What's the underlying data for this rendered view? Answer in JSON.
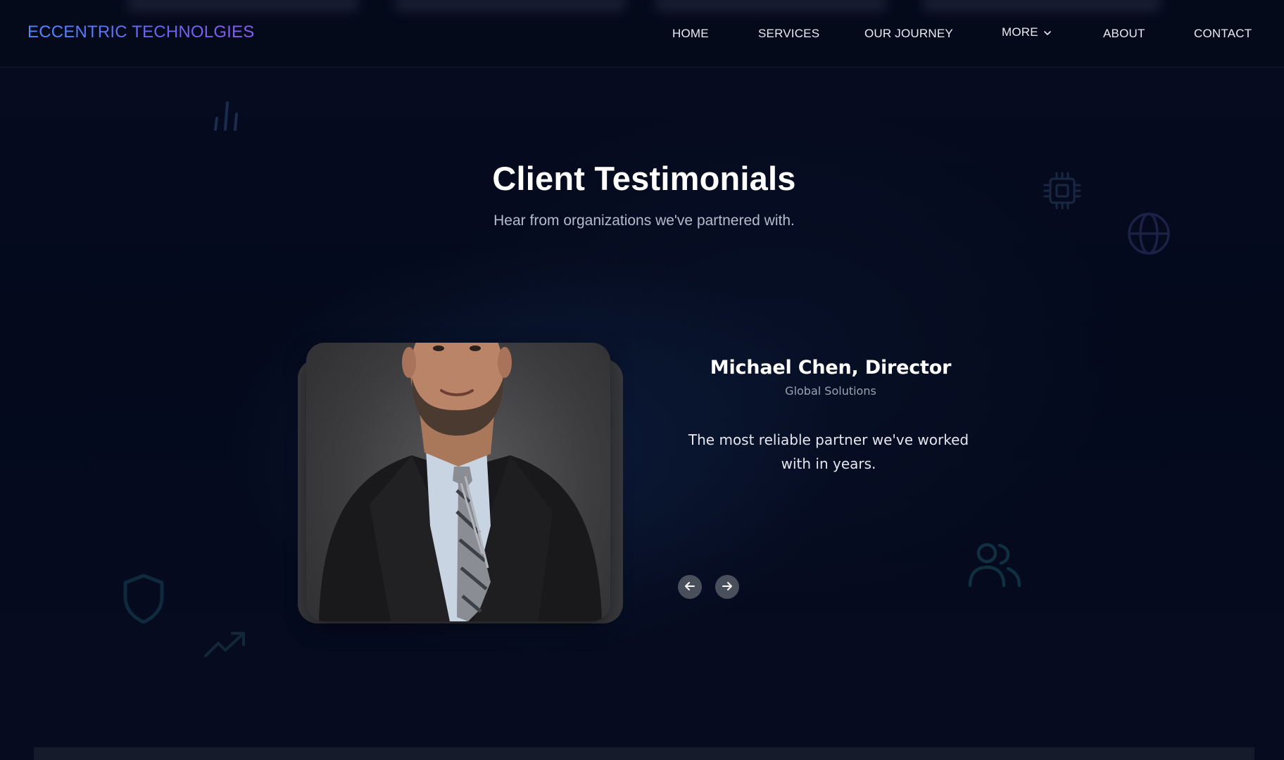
{
  "header": {
    "logo": "ECCENTRIC TECHNOLGIES",
    "nav": {
      "home": "HOME",
      "services": "SERVICES",
      "journey": "OUR JOURNEY",
      "more": "MORE",
      "about": "ABOUT",
      "contact": "CONTACT"
    }
  },
  "testimonials": {
    "title": "Client Testimonials",
    "subtitle": "Hear from organizations we've partnered with.",
    "current": {
      "name": "Michael Chen, Director",
      "company": "Global Solutions",
      "quote": "The most reliable partner we've worked with in years."
    }
  },
  "icons": {
    "nav_more": "chevron-down-icon",
    "prev": "arrow-left-icon",
    "next": "arrow-right-icon",
    "decorative": [
      "bar-chart-icon",
      "cpu-chip-icon",
      "globe-icon",
      "shield-icon",
      "trending-up-icon",
      "users-icon"
    ]
  },
  "colors": {
    "background": "#050a1c",
    "logo_gradient_start": "#4f89ff",
    "logo_gradient_end": "#8a5cf0",
    "arrow_button": "#4a4f5c"
  }
}
